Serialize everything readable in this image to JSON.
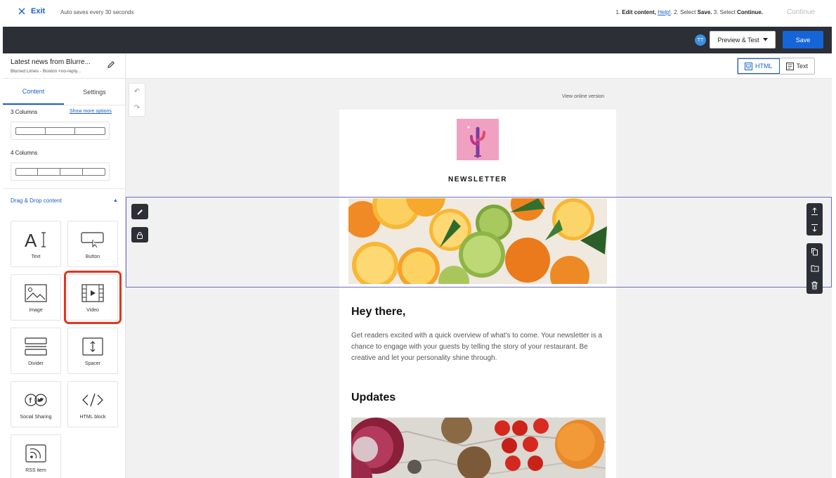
{
  "topbar": {
    "exit_label": "Exit",
    "autosave_text": "Auto saves every 30 seconds",
    "steps": {
      "step1_prefix": "1.",
      "step1_bold": "Edit content,",
      "step1_link": "Help!",
      "step2_prefix": ". 2. Select",
      "step2_bold": "Save.",
      "step3_prefix": "3. Select",
      "step3_bold": "Continue."
    },
    "continue_label": "Continue"
  },
  "header": {
    "avatar_initials": "TT",
    "preview_label": "Preview & Test",
    "save_label": "Save"
  },
  "sidebar": {
    "campaign_title": "Latest news from Blurre...",
    "campaign_sender": "Blurred Limes - Boston <no-reply...",
    "tabs": [
      {
        "label": "Content",
        "active": true
      },
      {
        "label": "Settings",
        "active": false
      }
    ],
    "layouts": {
      "three_columns_label": "3 Columns",
      "show_more_label": "Show more options",
      "four_columns_label": "4 Columns"
    },
    "dnd_header": "Drag & Drop content",
    "tiles": [
      {
        "label": "Text",
        "icon": "text-icon"
      },
      {
        "label": "Button",
        "icon": "button-icon"
      },
      {
        "label": "Image",
        "icon": "image-icon"
      },
      {
        "label": "Video",
        "icon": "video-icon",
        "highlighted": true
      },
      {
        "label": "Divider",
        "icon": "divider-icon"
      },
      {
        "label": "Spacer",
        "icon": "spacer-icon"
      },
      {
        "label": "Social Sharing",
        "icon": "social-sharing-icon"
      },
      {
        "label": "HTML block",
        "icon": "html-block-icon"
      },
      {
        "label": "RSS item",
        "icon": "rss-icon"
      }
    ]
  },
  "canvas": {
    "view_toggle": {
      "html_label": "HTML",
      "text_label": "Text",
      "active": "HTML"
    },
    "view_online": "View online version",
    "email": {
      "newsletter_title": "NEWSLETTER",
      "greeting": "Hey there,",
      "body": "Get readers excited with a quick overview of what's to come. Your newsletter is a chance to engage with your guests by telling the story of your restaurant. Be creative and let your personality shine through.",
      "updates_title": "Updates"
    }
  },
  "colors": {
    "accent": "#1565d8",
    "dark_bar": "#2c2f36",
    "highlight": "#e5341d",
    "selection": "#6d6bbf",
    "logo_bg": "#f0a1c2"
  }
}
